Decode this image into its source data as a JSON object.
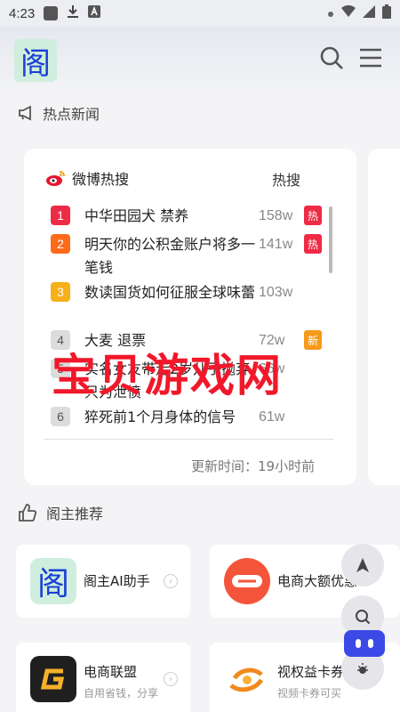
{
  "status_bar": {
    "time": "4:23"
  },
  "header": {
    "logo_char": "阁"
  },
  "sections": {
    "hot_news": "热点新闻",
    "recommend": "阁主推荐"
  },
  "weibo": {
    "title": "微博热搜",
    "tag": "热搜",
    "items": [
      {
        "rank": "1",
        "title": "中华田园犬 禁养",
        "count": "158w",
        "badge": "热",
        "rank_color": "#ee2b45",
        "badge_color": "#ee2b45"
      },
      {
        "rank": "2",
        "title": "明天你的公积金账户将多一笔钱",
        "count": "141w",
        "badge": "热",
        "rank_color": "#ff6b1a",
        "badge_color": "#ee2b45"
      },
      {
        "rank": "3",
        "title": "数读国货如何征服全球味蕾",
        "count": "103w",
        "badge": "",
        "rank_color": "#f6b018",
        "badge_color": ""
      },
      {
        "rank": "4",
        "title": "大麦 退票",
        "count": "72w",
        "badge": "新",
        "rank_color": "#dcdcdc",
        "badge_color": "#f59a1b"
      },
      {
        "rank": "5",
        "title": "实名女友带走2岁儿子抛弃只为泄愤",
        "count": "66w",
        "badge": "",
        "rank_color": "#dcdcdc",
        "badge_color": ""
      },
      {
        "rank": "6",
        "title": "猝死前1个月身体的信号",
        "count": "61w",
        "badge": "",
        "rank_color": "#dcdcdc",
        "badge_color": ""
      }
    ],
    "update_time": "更新时间：19小时前"
  },
  "watermark": "宝贝游戏网",
  "tiles": [
    {
      "title": "阁主AI助手",
      "subtitle": "",
      "icon": "ge-logo-icon"
    },
    {
      "title": "电商大额优惠",
      "subtitle": "",
      "icon": "coupon-report-icon"
    },
    {
      "title": "电商联盟",
      "subtitle": "自用省钱，分享",
      "icon": "g-logo-icon"
    },
    {
      "title": "视权益卡券",
      "subtitle": "视频卡券可买",
      "icon": "swirl-logo-icon"
    }
  ],
  "colors": {
    "accent": "#ee2b45",
    "brand_blue": "#3b4ae6"
  }
}
